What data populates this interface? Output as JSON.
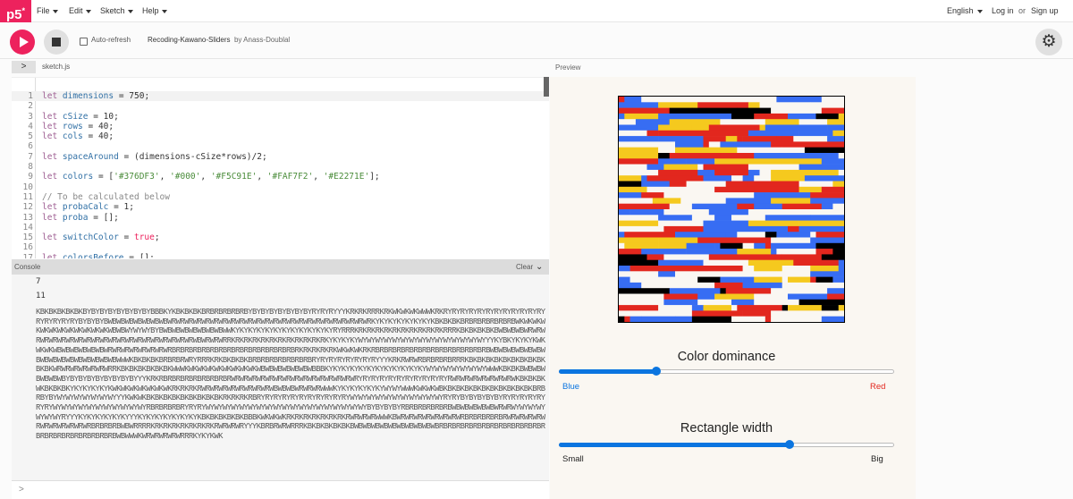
{
  "nav": {
    "logo": "p5",
    "logo_mark": "*",
    "menus": [
      "File",
      "Edit",
      "Sketch",
      "Help"
    ],
    "language": "English",
    "login": "Log in",
    "or": "or",
    "signup": "Sign up"
  },
  "toolbar": {
    "autorefresh_label": "Auto-refresh",
    "autorefresh_checked": false,
    "sketch_name": "Recoding-Kawano-Sliders",
    "byline": "by Anass-Doublal",
    "accent_color": "#ed225d"
  },
  "editor": {
    "tab_name": "sketch.js",
    "active_line": 1,
    "lines": [
      {
        "n": "1",
        "tokens": [
          [
            "kw",
            "let "
          ],
          [
            "var",
            "dimensions"
          ],
          [
            "",
            " = "
          ],
          [
            "num",
            "750"
          ],
          [
            "",
            ";"
          ]
        ]
      },
      {
        "n": "2",
        "tokens": []
      },
      {
        "n": "3",
        "tokens": [
          [
            "kw",
            "let "
          ],
          [
            "var",
            "cSize"
          ],
          [
            "",
            " = "
          ],
          [
            "num",
            "10"
          ],
          [
            "",
            ";"
          ]
        ]
      },
      {
        "n": "4",
        "tokens": [
          [
            "kw",
            "let "
          ],
          [
            "var",
            "rows"
          ],
          [
            "",
            " = "
          ],
          [
            "num",
            "40"
          ],
          [
            "",
            ";"
          ]
        ]
      },
      {
        "n": "5",
        "tokens": [
          [
            "kw",
            "let "
          ],
          [
            "var",
            "cols"
          ],
          [
            "",
            " = "
          ],
          [
            "num",
            "40"
          ],
          [
            "",
            ";"
          ]
        ]
      },
      {
        "n": "6",
        "tokens": []
      },
      {
        "n": "7",
        "tokens": [
          [
            "kw",
            "let "
          ],
          [
            "var",
            "spaceAround"
          ],
          [
            "",
            " = (dimensions-cSize*rows)/2;"
          ]
        ]
      },
      {
        "n": "8",
        "tokens": []
      },
      {
        "n": "9",
        "tokens": [
          [
            "kw",
            "let "
          ],
          [
            "var",
            "colors"
          ],
          [
            "",
            " = ["
          ],
          [
            "str",
            "'#376DF3'"
          ],
          [
            "",
            ", "
          ],
          [
            "str",
            "'#000'"
          ],
          [
            "",
            ", "
          ],
          [
            "str",
            "'#F5C91E'"
          ],
          [
            "",
            ", "
          ],
          [
            "str",
            "'#FAF7F2'"
          ],
          [
            "",
            ", "
          ],
          [
            "str",
            "'#E2271E'"
          ],
          [
            "",
            "];"
          ]
        ]
      },
      {
        "n": "10",
        "tokens": []
      },
      {
        "n": "11",
        "tokens": [
          [
            "com",
            "// To be calculated below"
          ]
        ]
      },
      {
        "n": "12",
        "tokens": [
          [
            "kw",
            "let "
          ],
          [
            "var",
            "probaCalc"
          ],
          [
            "",
            " = "
          ],
          [
            "num",
            "1"
          ],
          [
            "",
            ";"
          ]
        ]
      },
      {
        "n": "13",
        "tokens": [
          [
            "kw",
            "let "
          ],
          [
            "var",
            "proba"
          ],
          [
            "",
            " = [];"
          ]
        ]
      },
      {
        "n": "14",
        "tokens": []
      },
      {
        "n": "15",
        "tokens": [
          [
            "kw",
            "let "
          ],
          [
            "var",
            "switchColor"
          ],
          [
            "",
            " = "
          ],
          [
            "bool",
            "true"
          ],
          [
            "",
            ";"
          ]
        ]
      },
      {
        "n": "16",
        "tokens": []
      },
      {
        "n": "17",
        "tokens": [
          [
            "kw",
            "let "
          ],
          [
            "var",
            "colorsBefore"
          ],
          [
            "",
            " = [];"
          ]
        ]
      }
    ]
  },
  "console": {
    "title": "Console",
    "clear_label": "Clear",
    "log_numbers": [
      "7",
      "11"
    ],
    "log_text": "KBKBKBKBKBKBYBYBYBYBYBYBYBYBBBKYKBKBKBKBRBRBRBRBRBYBYBYBYBYBYBYBYRYRYRYYYKRKRKRRRKRKWKWKWKWWWKRKRYRYRYRYRYRYRYRYRYRYRYRYRYRYRYRYRYBYBYBYBWBWBWBWBWBWBWBWRWRWRWRWRWRWRWRWRWRWRWRWRWRWRWRWRWRWRWRWRWRWRWRKYKYKYKYKYKYKYKBKBKBKBRBRBRBRBRBRBWKWKWKWKWKWKWKWKWKWKWKWKWBWBWYWYWYBYBWBWBWBWBWBWBWBWWKYKYKYKYKYKYKYKYKYKYKYKYRYRRRKRKRKRKRKRKRKRKRKRKRKRRRKBKBKBKBKBWBWBWBWRWRWRWRWRWRWRWRWRWRWRWRWRWRWRWRWRWRWRWRWRWBWRWRWRRKRKRKRKRKRKRKRKRKRKRKRKYKYKYKYWYWYWYWYWYWYWYWYWYWYWYWYWYWYWYYYKYBKYKYKYKWKWKWKWBWBWBWBWBWBWRWRWRWRWRWRWRWRBRBRBRBRBRBRBRBRBRBRBRBRBRBRBRKRKRKRKRKWKWKWKRKRBRBRBRBRBRBRBRBRBRBRBRBRBRBWBWBWBWBWBWBWBWBWBWBWBWBWBWBWBWBWWWKBKBKBKBRBRBRWRYRRRKRKBKBKBKBRBRBRBRBRBRBRBRYRYRYRYRYRYRYRYYYKRKRWRWRBRBRBRBRRRKBKBKBKBKBKBKBKBKBKBKBKWRWRWRWRWRWRWRRKBKBKBKBKBKBKWWWKWKWKWKWKWKWKWKWKWBWBWBWBWBWBWBBBKYKYKYKYKYKYKYKYKYKYKYKYWYWYWYWYWYWYWYWWWKBKBKBWBWBWBWBWBWBYBYBYBYBYBYBYBYBYYYKRKRBRBRBRBRBRBRBRBRWRWRWRWRWRWRWRWRWRWRWRWRWRWRWRYRYRYRYRYRYRYRYRYRYRYRWRWRWRWRWRWRWRWKBKBKBKWKBKBKBKYKYKYKYKYKWKWKWKWKWKWKWKRKRKRKRWRWRWRWRWRWRWRWRWBWBWBWRWRWRWWWKYKYKYKYKYKYWYWYWWWKWKWKWBKBKBKBKBKBKBKBKBKBKBKBRBRBYBYWYWYWYWYWYWYWYYYKWKWKBKBKBKBKBKBKBKBKBKRKRKRKRBRYRYRYRYRYRYRYRYRYRYRYWYWYWYWYWYWYWYWYWYWYWYRYRYBYBYBYBYBYRYRYRYRYRYRYRYWYWYWYWYWYWYWYWYWYWYWYRBRBRBRBRYRYRYWYWYWYWYWYWYWYWYWYWYWYWYWYWYWYWYWYWYWYBYBYBYBYRBRBRBRBRBRBWBWBWBWBWBWRWRWYWYWYWYWYWYWYRYYYKYKYKYKYKYKYYYKYKYKYKYKYKYKYKBKBKBKBKBKBBBKWKWKWKRKRKRKRKRKRKRKRWRWRWRWWWKBWRWRWRWRWRWRWRWRBRBRBRBRBRWRWRWRWRWRWRWRWRWRWRWRBRBRBRBWBWRRRRKRKRKRKRKRKRKRKRWRWRWRYYYKBRBRWRWRRRKBKBKBKBKBKBWBWBWBWBWBWBWBWBWBWBRBRBRBRBRBRBRBRBRBRBRBRBRBRBRBRBRBRBRBRBRBRBWBWWWKWRWRWRWRWRRRKYKYKWK"
  },
  "preview": {
    "label": "Preview",
    "palette": [
      "#376DF3",
      "#000",
      "#F5C91E",
      "#FAF7F2",
      "#E2271E"
    ],
    "sliders": [
      {
        "title": "Color dominance",
        "min_label": "Blue",
        "max_label": "Red",
        "value": 0.29,
        "min_color": "#0b75e0",
        "max_color": "#e2271e"
      },
      {
        "title": "Rectangle width",
        "min_label": "Small",
        "max_label": "Big",
        "value": 0.69,
        "min_color": "#222",
        "max_color": "#222"
      }
    ]
  }
}
